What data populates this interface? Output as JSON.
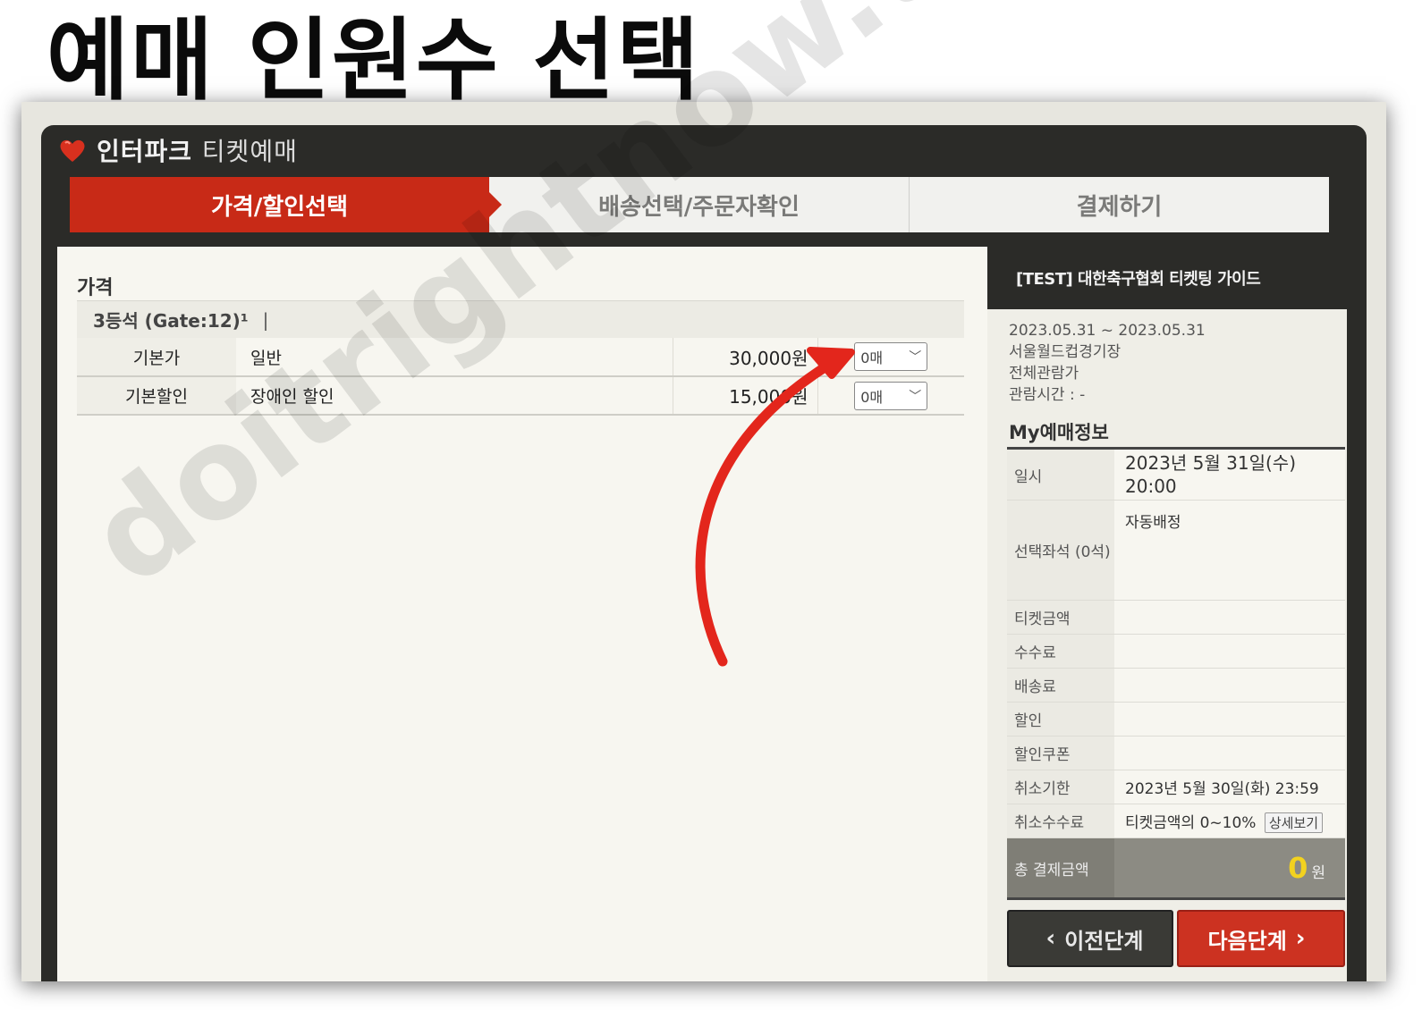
{
  "headline": "예매 인원수 선택",
  "app": {
    "brand": "인터파크",
    "brand_sub": "티켓예매"
  },
  "steps": [
    {
      "label": "가격/할인선택",
      "active": true
    },
    {
      "label": "배송선택/주문자확인",
      "active": false
    },
    {
      "label": "결제하기",
      "active": false
    }
  ],
  "price": {
    "title": "가격",
    "grade": "3등석 (Gate:12)¹",
    "grade_sep": "|",
    "rows": [
      {
        "type": "기본가",
        "name": "일반",
        "price": "30,000원",
        "qty": "0매"
      },
      {
        "type": "기본할인",
        "name": "장애인 할인",
        "price": "15,000원",
        "qty": "0매"
      }
    ]
  },
  "show": {
    "title": "[TEST] 대한축구협회 티켓팅 가이드",
    "dates": "2023.05.31 ~ 2023.05.31",
    "venue": "서울월드컵경기장",
    "rating": "전체관람가",
    "runtime": "관람시간 : -"
  },
  "my": {
    "title": "My예매정보",
    "datetime_label": "일시",
    "datetime_value": "2023년 5월 31일(수) 20:00",
    "seat_label": "선택좌석 (0석)",
    "seat_value": "자동배정",
    "ticket_label": "티켓금액",
    "fee_label": "수수료",
    "delivery_label": "배송료",
    "discount_label": "할인",
    "coupon_label": "할인쿠폰",
    "cancel_deadline_label": "취소기한",
    "cancel_deadline_value": "2023년 5월 30일(화) 23:59",
    "cancel_fee_label": "취소수수료",
    "cancel_fee_value": "티켓금액의 0~10%",
    "detail_button": "상세보기",
    "total_label": "총 결제금액",
    "total_value": "0",
    "total_unit": "원"
  },
  "nav": {
    "prev": "이전단계",
    "next": "다음단계"
  },
  "watermark": "doitrightnow.tistory.com",
  "colors": {
    "accent_red": "#c82a17",
    "dark": "#2b2b28",
    "total_yellow": "#f3d21f",
    "arrow_red": "#e3261c"
  }
}
